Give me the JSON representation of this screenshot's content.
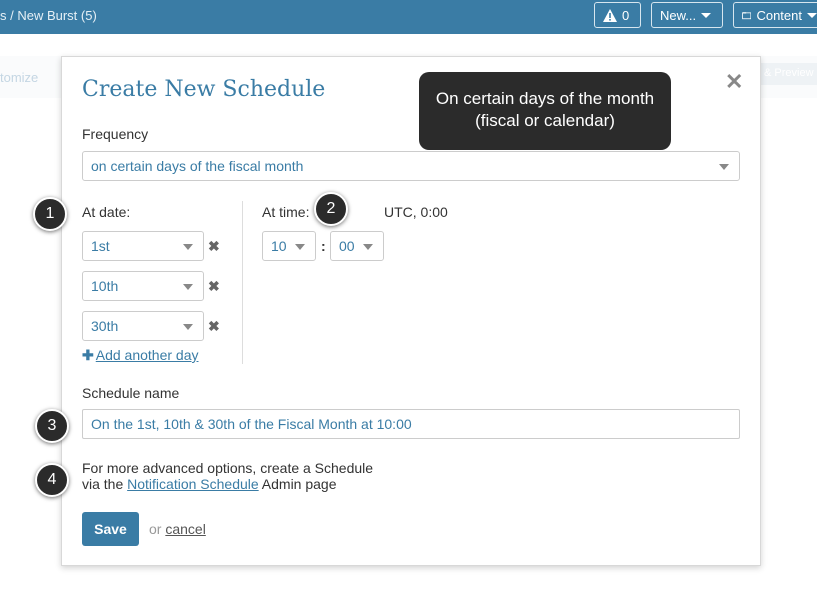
{
  "topbar": {
    "breadcrumb": "s / New Burst (5)",
    "alert_count": "0",
    "new_label": "New...",
    "content_label": "Content"
  },
  "background": {
    "left_text": "tomize",
    "right_text": "& Preview"
  },
  "modal": {
    "title": "Create New Schedule",
    "close_glyph": "✕",
    "tooltip": "On certain days of the month (fiscal or calendar)",
    "frequency": {
      "label": "Frequency",
      "value": "on certain days of the fiscal month"
    },
    "dates": {
      "label": "At date:",
      "days": [
        "1st",
        "10th",
        "30th"
      ],
      "remove_glyph": "✖",
      "add_label": "Add another day",
      "add_glyph": "✚"
    },
    "time": {
      "label": "At time:",
      "timezone": "UTC, 0:00",
      "hour": "10",
      "separator": ":",
      "minute": "00"
    },
    "schedule_name": {
      "label": "Schedule name",
      "value": "On the 1st, 10th & 30th of the Fiscal Month at 10:00"
    },
    "help": {
      "line1": "For more advanced options, create a Schedule",
      "line2_pre": "via the ",
      "link": "Notification Schedule",
      "line2_post": " Admin page"
    },
    "save_label": "Save",
    "or_text": "or ",
    "cancel_label": "cancel"
  },
  "callouts": [
    "1",
    "2",
    "3",
    "4"
  ]
}
